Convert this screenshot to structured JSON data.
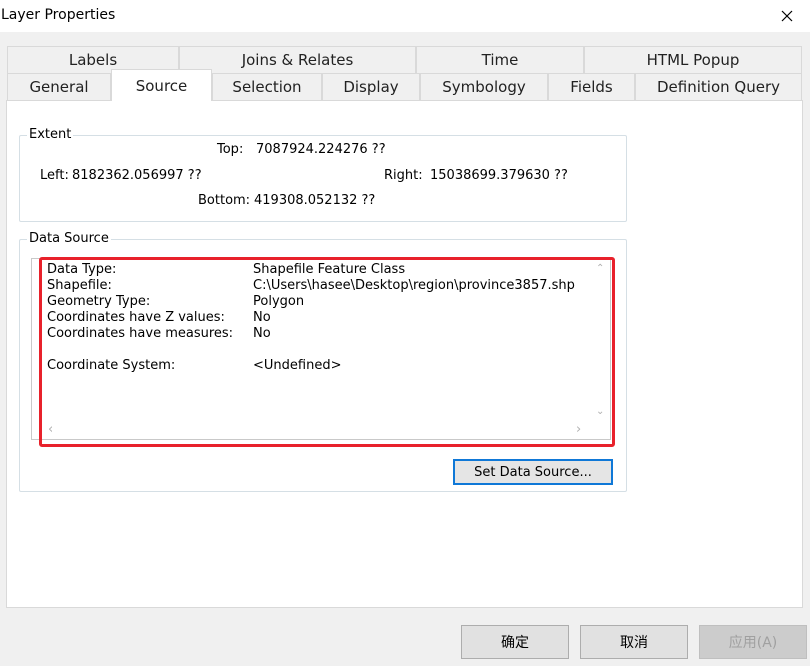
{
  "window": {
    "title": "Layer Properties",
    "close_symbol": "✕"
  },
  "tabs": {
    "row1": [
      "Labels",
      "Joins & Relates",
      "Time",
      "HTML Popup"
    ],
    "row2": [
      "General",
      "Source",
      "Selection",
      "Display",
      "Symbology",
      "Fields",
      "Definition Query"
    ],
    "active": "Source"
  },
  "extent": {
    "title": "Extent",
    "top_label": "Top:",
    "top_value": "7087924.224276 ??",
    "left_label": "Left:",
    "left_value": "8182362.056997 ??",
    "right_label": "Right:",
    "right_value": "15038699.379630 ??",
    "bottom_label": "Bottom:",
    "bottom_value": "419308.052132 ??"
  },
  "data_source": {
    "title": "Data Source",
    "rows": [
      {
        "label": "Data Type:",
        "value": "Shapefile Feature Class"
      },
      {
        "label": "Shapefile:",
        "value": "C:\\Users\\hasee\\Desktop\\region\\province3857.shp"
      },
      {
        "label": "Geometry Type:",
        "value": "Polygon"
      },
      {
        "label": "Coordinates have Z values:",
        "value": "No"
      },
      {
        "label": "Coordinates have measures:",
        "value": "No"
      },
      {
        "label": "Coordinate System:",
        "value": "<Undefined>"
      }
    ],
    "set_button": "Set Data Source...",
    "highlight_color": "#e8212b"
  },
  "buttons": {
    "ok": "确定",
    "cancel": "取消",
    "apply": "应用(A)"
  }
}
